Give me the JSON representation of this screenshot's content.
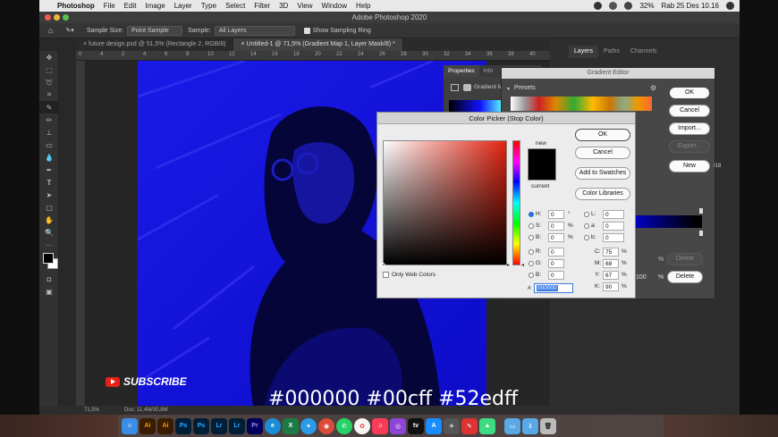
{
  "menubar": {
    "app": "Photoshop",
    "items": [
      "File",
      "Edit",
      "Image",
      "Layer",
      "Type",
      "Select",
      "Filter",
      "3D",
      "View",
      "Window",
      "Help"
    ],
    "battery": "32%",
    "datetime": "Rab 25 Des 10.16"
  },
  "titlebar": {
    "title": "Adobe Photoshop 2020"
  },
  "options": {
    "sample_size_label": "Sample Size:",
    "sample_size_value": "Point Sample",
    "sample_label": "Sample:",
    "sample_value": "All Layers",
    "show_ring": "Show Sampling Ring"
  },
  "tabs": [
    {
      "label": "future design.psd @ 51,5% (Rectangle 2, RGB/8)"
    },
    {
      "label": "Untitled-1 @ 71,5% (Gradient Map 1, Layer Mask/8) *"
    }
  ],
  "ruler_ticks": [
    "0",
    "4",
    "2",
    "4",
    "6",
    "8",
    "10",
    "12",
    "14",
    "16",
    "18",
    "20",
    "22",
    "24",
    "26",
    "28",
    "30",
    "32",
    "34",
    "36",
    "38",
    "40"
  ],
  "status": {
    "zoom": "71,5%",
    "doc": "Doc: 11,4M/30,8M"
  },
  "panels": {
    "layers": "Layers",
    "paths": "Paths",
    "channels": "Channels",
    "properties": "Properties",
    "info": "Info",
    "gradient_map": "Gradient M"
  },
  "gradient_editor": {
    "title": "Gradient Editor",
    "presets": "Presets",
    "ok": "OK",
    "cancel": "Cancel",
    "import": "Import...",
    "export": "Export...",
    "new": "New",
    "delete": "Delete",
    "delete2": "Delete",
    "pct": "%",
    "pct2": "%",
    "val100": "100",
    "side": "/18"
  },
  "color_picker": {
    "title": "Color Picker (Stop Color)",
    "new_label": "new",
    "current_label": "current",
    "ok": "OK",
    "cancel": "Cancel",
    "add_swatches": "Add to Swatches",
    "libraries": "Color Libraries",
    "only_web": "Only Web Colors",
    "hex_label": "#",
    "hex": "000000",
    "fields": {
      "H": "0",
      "S": "0",
      "B": "0",
      "R": "0",
      "G": "0",
      "Bv": "0",
      "L": "0",
      "a": "0",
      "b": "0",
      "C": "75",
      "M": "68",
      "Y": "67",
      "K": "90"
    },
    "units": {
      "deg": "°",
      "pct": "%"
    }
  },
  "overlay": {
    "subscribe": "SUBSCRIBE",
    "caption": "#000000 #00cff #52edff"
  },
  "dock": [
    "Finder",
    "Ai",
    "Ai",
    "Ps",
    "Ps",
    "Lr",
    "Lr",
    "Pr",
    "Edge",
    "Excel",
    "Safari",
    "Chrome",
    "WA",
    "Photos",
    "Music",
    "Podcast",
    "TV",
    "AppStore",
    "Launch",
    "Quill",
    "Android",
    "Folder",
    "Trash"
  ]
}
